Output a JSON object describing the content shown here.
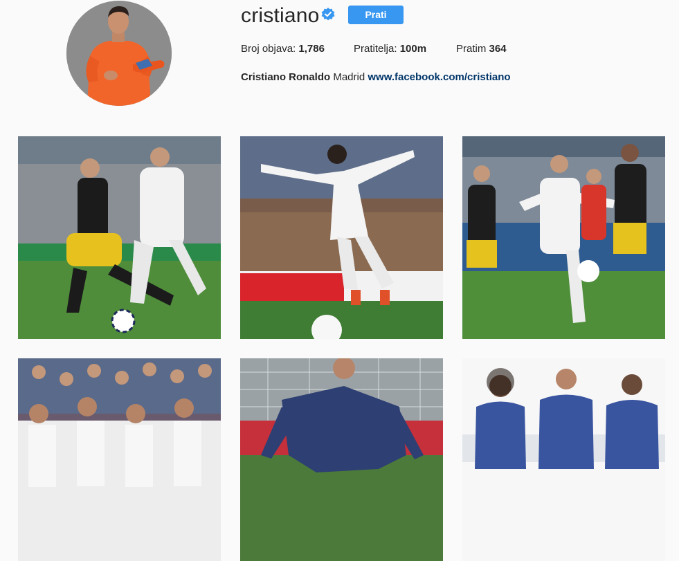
{
  "profile": {
    "username": "cristiano",
    "verified_icon": "verified-badge-icon",
    "follow_label": "Prati",
    "stats": {
      "posts_label": "Broj objava:",
      "posts_value": "1,786",
      "followers_label": "Pratitelja:",
      "followers_value": "100m",
      "following_label": "Pratim",
      "following_value": "364"
    },
    "bio": {
      "full_name": "Cristiano Ronaldo",
      "location": "Madrid",
      "link": "www.facebook.com/cristiano"
    }
  },
  "colors": {
    "accent": "#3897f0",
    "link": "#003569",
    "background": "#fafafa"
  }
}
